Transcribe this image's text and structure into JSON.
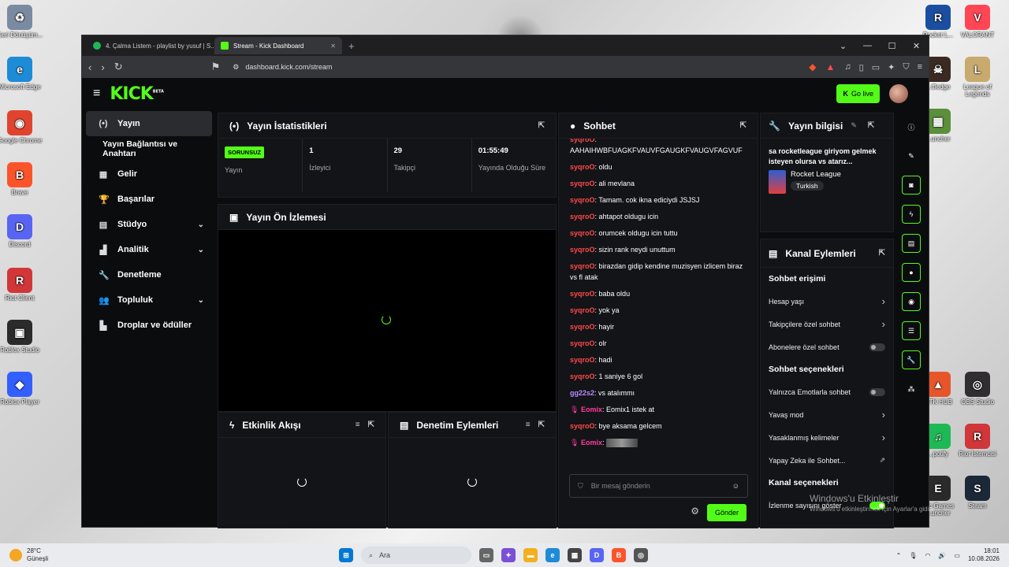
{
  "desktop": {
    "left_icons": [
      {
        "label": "Geri Dönüşüm...",
        "color": "#7a8aa0",
        "glyph": "♻"
      },
      {
        "label": "Microsoft Edge",
        "color": "#1e8bd6",
        "glyph": "e"
      },
      {
        "label": "Google Chrome",
        "color": "#e0442f",
        "glyph": "◉"
      },
      {
        "label": "Brave",
        "color": "#fb542b",
        "glyph": "B"
      },
      {
        "label": "Discord",
        "color": "#5865f2",
        "glyph": "D"
      },
      {
        "label": "Riot Client",
        "color": "#d13639",
        "glyph": "R"
      },
      {
        "label": "Roblox Studio",
        "color": "#2b2b2b",
        "glyph": "▣"
      },
      {
        "label": "Roblox Player",
        "color": "#335fff",
        "glyph": "◆"
      }
    ],
    "right_icons": [
      {
        "label": "Rocket L...",
        "color": "#1b4ea0",
        "glyph": "R"
      },
      {
        "label": "VALORANT",
        "color": "#ff4655",
        "glyph": "V"
      },
      {
        "label": "...tfledge",
        "color": "#3a2a22",
        "glyph": "☠"
      },
      {
        "label": "League of Legends",
        "color": "#c8aa6e",
        "glyph": "L"
      },
      {
        "label": "...uncher",
        "color": "#5a8f3b",
        "glyph": "▦"
      },
      {
        "label": "...TK HUB",
        "color": "#e7552b",
        "glyph": "▲"
      },
      {
        "label": "OBS Studio",
        "color": "#302e31",
        "glyph": "◎"
      },
      {
        "label": "...potify",
        "color": "#1db954",
        "glyph": "♫"
      },
      {
        "label": "Riot İstemcisi",
        "color": "#d13639",
        "glyph": "R"
      },
      {
        "label": "...ic Games ...uncher",
        "color": "#2a2a2a",
        "glyph": "E"
      },
      {
        "label": "Steam",
        "color": "#1b2838",
        "glyph": "S"
      }
    ]
  },
  "browser": {
    "tabs": [
      {
        "label": "4. Çalma Listem - playlist by yusuf | S...",
        "icon": "spotify-icon",
        "color": "#1db954"
      },
      {
        "label": "Stream - Kick Dashboard",
        "icon": "kick-icon",
        "color": "#53fc18"
      }
    ],
    "new_tab": "+",
    "controls": {
      "dropdown": "⌄",
      "minimize": "—",
      "maximize": "☐",
      "close": "✕"
    },
    "url": "dashboard.kick.com/stream"
  },
  "kick": {
    "logo": "KICK",
    "logo_sup": "BETA",
    "go_live": "Go live",
    "sidebar": [
      {
        "label": "Yayın",
        "icon": "(•)",
        "active": true
      },
      {
        "label": "Yayın Bağlantısı ve Anahtarı",
        "icon": "",
        "sub": true
      },
      {
        "label": "Gelir",
        "icon": "▦"
      },
      {
        "label": "Başarılar",
        "icon": "🏆"
      },
      {
        "label": "Stüdyo",
        "icon": "▤",
        "chevron": "⌄"
      },
      {
        "label": "Analitik",
        "icon": "▟",
        "chevron": "⌄"
      },
      {
        "label": "Denetleme",
        "icon": "🔧"
      },
      {
        "label": "Topluluk",
        "icon": "👥",
        "chevron": "⌄"
      },
      {
        "label": "Droplar ve ödüller",
        "icon": "▙"
      }
    ],
    "stats": {
      "title": "Yayın İstatistikleri",
      "badge": "SORUNSUZ",
      "items": [
        {
          "value": "",
          "label": "Yayın"
        },
        {
          "value": "1",
          "label": "İzleyici"
        },
        {
          "value": "29",
          "label": "Takipçi"
        },
        {
          "value": "01:55:49",
          "label": "Yayında Olduğu Süre"
        }
      ]
    },
    "preview": {
      "title": "Yayın Ön İzlemesi"
    },
    "activity": {
      "title": "Etkinlik Akışı"
    },
    "modactions": {
      "title": "Denetim Eylemleri"
    },
    "chat": {
      "title": "Sohbet",
      "messages": [
        {
          "user": "syqroO",
          "text": "AAHAIHWBFUAGKFVAUVFGAUGKFVAUGVFAGVUF",
          "style": "u"
        },
        {
          "user": "syqroO",
          "text": "oldu",
          "style": "u"
        },
        {
          "user": "syqroO",
          "text": "ali mevlana",
          "style": "u"
        },
        {
          "user": "syqroO",
          "text": "Tamam. cok ikna ediciydi JSJSJ",
          "style": "u"
        },
        {
          "user": "syqroO",
          "text": "ahtapot oldugu icin",
          "style": "u"
        },
        {
          "user": "syqroO",
          "text": "orumcek oldugu icin tuttu",
          "style": "u"
        },
        {
          "user": "syqroO",
          "text": "sizin rank neydi unuttum",
          "style": "u"
        },
        {
          "user": "syqroO",
          "text": "birazdan gidip kendine muzisyen izlicem biraz vs fl atak",
          "style": "u"
        },
        {
          "user": "syqroO",
          "text": "baba oldu",
          "style": "u"
        },
        {
          "user": "syqroO",
          "text": "yok ya",
          "style": "u"
        },
        {
          "user": "syqroO",
          "text": "hayir",
          "style": "u"
        },
        {
          "user": "syqroO",
          "text": "olr",
          "style": "u"
        },
        {
          "user": "syqroO",
          "text": "hadi",
          "style": "u"
        },
        {
          "user": "syqroO",
          "text": "1 saniye 6 gol",
          "style": "u"
        },
        {
          "user": "gg22s2",
          "text": "vs atalımmı",
          "style": "u2"
        },
        {
          "user": "Eomix",
          "text": "Eomix1 istek at",
          "style": "u3"
        },
        {
          "user": "syqroO",
          "text": "bye aksama gelcem",
          "style": "u"
        },
        {
          "user": "Eomix",
          "text": "",
          "style": "u3"
        }
      ],
      "placeholder": "Bir mesaj gönderin",
      "send": "Gönder"
    },
    "info": {
      "title": "Yayın bilgisi",
      "stream_title": "sa rocketleague giriyom gelmek isteyen olursa vs atarız...",
      "category": "Rocket League",
      "language": "Turkish"
    },
    "channel": {
      "title": "Kanal Eylemleri",
      "sections": [
        {
          "heading": "Sohbet erişimi",
          "rows": [
            {
              "label": "Hesap yaşı",
              "type": "arrow"
            },
            {
              "label": "Takipçilere özel sohbet",
              "type": "arrow"
            },
            {
              "label": "Abonelere özel sohbet",
              "type": "toggle"
            }
          ]
        },
        {
          "heading": "Sohbet seçenekleri",
          "rows": [
            {
              "label": "Yalnızca Emotlarla sohbet",
              "type": "toggle"
            },
            {
              "label": "Yavaş mod",
              "type": "arrow"
            },
            {
              "label": "Yasaklanmış kelimeler",
              "type": "arrow"
            },
            {
              "label": "Yapay Zeka ile Sohbet...",
              "type": "ext"
            }
          ]
        },
        {
          "heading": "Kanal seçenekleri",
          "rows": [
            {
              "label": "İzlenme sayısını göster",
              "type": "toggle-on"
            }
          ]
        }
      ]
    }
  },
  "watermark": {
    "title": "Windows'u Etkinleştir",
    "sub": "Windows'u etkinleştirmek için Ayarlar'a gidin."
  },
  "taskbar": {
    "weather_temp": "28°C",
    "weather_desc": "Güneşli",
    "search": "Ara",
    "time": "18:01",
    "date": "10.08.2026"
  }
}
